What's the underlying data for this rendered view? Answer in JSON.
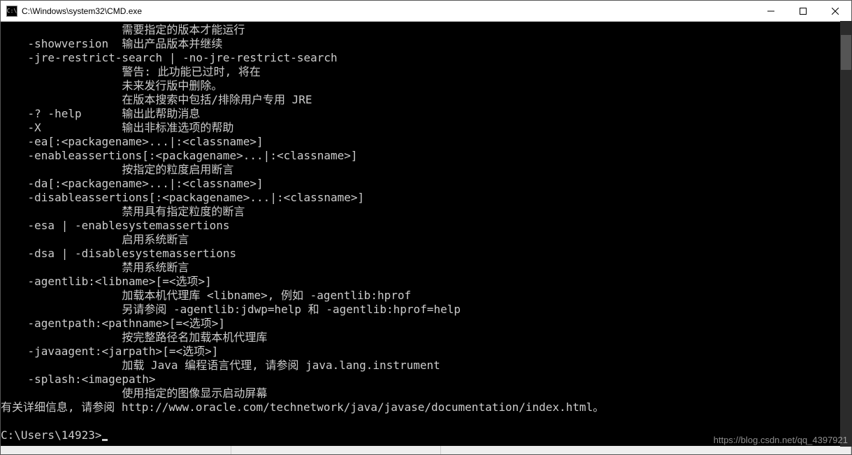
{
  "window": {
    "title": "C:\\Windows\\system32\\CMD.exe",
    "icon_label": "C:\\"
  },
  "terminal": {
    "lines": [
      "                  需要指定的版本才能运行",
      "    -showversion  输出产品版本并继续",
      "    -jre-restrict-search | -no-jre-restrict-search",
      "                  警告: 此功能已过时, 将在",
      "                  未来发行版中删除。",
      "                  在版本搜索中包括/排除用户专用 JRE",
      "    -? -help      输出此帮助消息",
      "    -X            输出非标准选项的帮助",
      "    -ea[:<packagename>...|:<classname>]",
      "    -enableassertions[:<packagename>...|:<classname>]",
      "                  按指定的粒度启用断言",
      "    -da[:<packagename>...|:<classname>]",
      "    -disableassertions[:<packagename>...|:<classname>]",
      "                  禁用具有指定粒度的断言",
      "    -esa | -enablesystemassertions",
      "                  启用系统断言",
      "    -dsa | -disablesystemassertions",
      "                  禁用系统断言",
      "    -agentlib:<libname>[=<选项>]",
      "                  加载本机代理库 <libname>, 例如 -agentlib:hprof",
      "                  另请参阅 -agentlib:jdwp=help 和 -agentlib:hprof=help",
      "    -agentpath:<pathname>[=<选项>]",
      "                  按完整路径名加载本机代理库",
      "    -javaagent:<jarpath>[=<选项>]",
      "                  加载 Java 编程语言代理, 请参阅 java.lang.instrument",
      "    -splash:<imagepath>",
      "                  使用指定的图像显示启动屏幕",
      "有关详细信息, 请参阅 http://www.oracle.com/technetwork/java/javase/documentation/index.html。",
      "",
      "C:\\Users\\14923>"
    ],
    "prompt_index": 29
  },
  "watermark": "https://blog.csdn.net/qq_4397921"
}
